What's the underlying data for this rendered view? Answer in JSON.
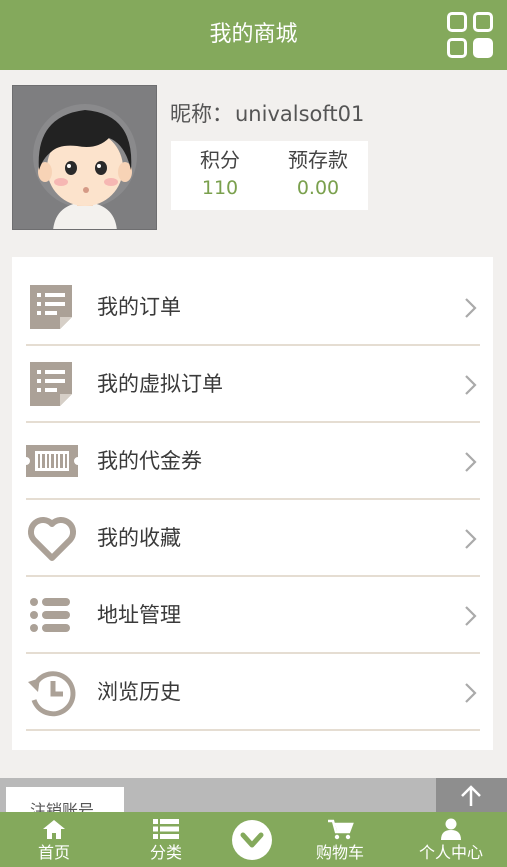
{
  "header": {
    "title": "我的商城",
    "menu_icon": "grid-icon"
  },
  "profile": {
    "nickname_label": "昵称：",
    "nickname": "univalsoft01",
    "points_label": "积分",
    "points_value": "110",
    "deposit_label": "预存款",
    "deposit_value": "0.00"
  },
  "menu": {
    "items": [
      {
        "label": "我的订单",
        "icon": "order-icon"
      },
      {
        "label": "我的虚拟订单",
        "icon": "virtual-order-icon"
      },
      {
        "label": "我的代金券",
        "icon": "voucher-icon"
      },
      {
        "label": "我的收藏",
        "icon": "heart-icon"
      },
      {
        "label": "地址管理",
        "icon": "list-icon"
      },
      {
        "label": "浏览历史",
        "icon": "history-icon"
      }
    ]
  },
  "footer": {
    "logout_label": "注销账号",
    "to_top_icon": "arrow-up-icon"
  },
  "tabbar": {
    "items": [
      {
        "label": "首页",
        "icon": "home-icon"
      },
      {
        "label": "分类",
        "icon": "category-icon"
      },
      {
        "label": "",
        "icon": "chevron-down-circle-icon"
      },
      {
        "label": "购物车",
        "icon": "cart-icon"
      },
      {
        "label": "个人中心",
        "icon": "user-icon"
      }
    ]
  },
  "colors": {
    "brand_green": "#84a95c",
    "value_green": "#7aa04d",
    "icon_gray": "#aba197"
  }
}
